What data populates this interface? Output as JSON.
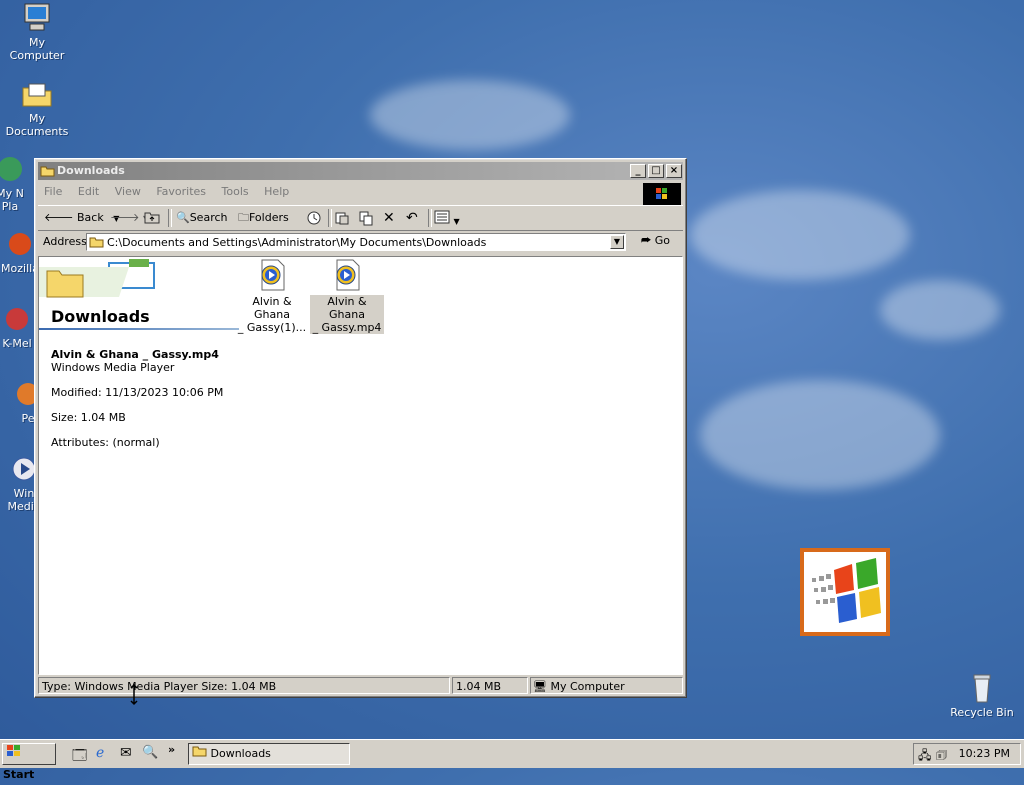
{
  "desktop": {
    "icons": [
      {
        "label": "My Computer"
      },
      {
        "label": "My Documents"
      },
      {
        "label": "My N"
      },
      {
        "label": "Pla"
      },
      {
        "label": "Mozilla"
      },
      {
        "label": "K-Mel"
      },
      {
        "label": "Pe"
      },
      {
        "label": "Win"
      },
      {
        "label": "Media"
      },
      {
        "label": "Recycle Bin"
      }
    ]
  },
  "window": {
    "title": "Downloads",
    "menu": [
      "File",
      "Edit",
      "View",
      "Favorites",
      "Tools",
      "Help"
    ],
    "toolbar": {
      "back": "Back",
      "search": "Search",
      "folders": "Folders"
    },
    "address": {
      "label": "Address",
      "value": "C:\\Documents and Settings\\Administrator\\My Documents\\Downloads",
      "go": "Go"
    },
    "left_panel": {
      "folder_title": "Downloads",
      "selected_name": "Alvin & Ghana _ Gassy.mp4",
      "selected_type": "Windows Media Player",
      "modified": "Modified: 11/13/2023 10:06 PM",
      "size": "Size: 1.04 MB",
      "attributes": "Attributes: (normal)"
    },
    "files": [
      {
        "line1": "Alvin & Ghana",
        "line2": "_ Gassy(1)..."
      },
      {
        "line1": "Alvin & Ghana",
        "line2": "_ Gassy.mp4"
      }
    ],
    "status": {
      "info": "Type: Windows Media Player Size: 1.04 MB",
      "size": "1.04 MB",
      "zone": "My Computer"
    }
  },
  "taskbar": {
    "start": "Start",
    "task": "Downloads",
    "time": "10:23 PM",
    "chevron": "»"
  }
}
